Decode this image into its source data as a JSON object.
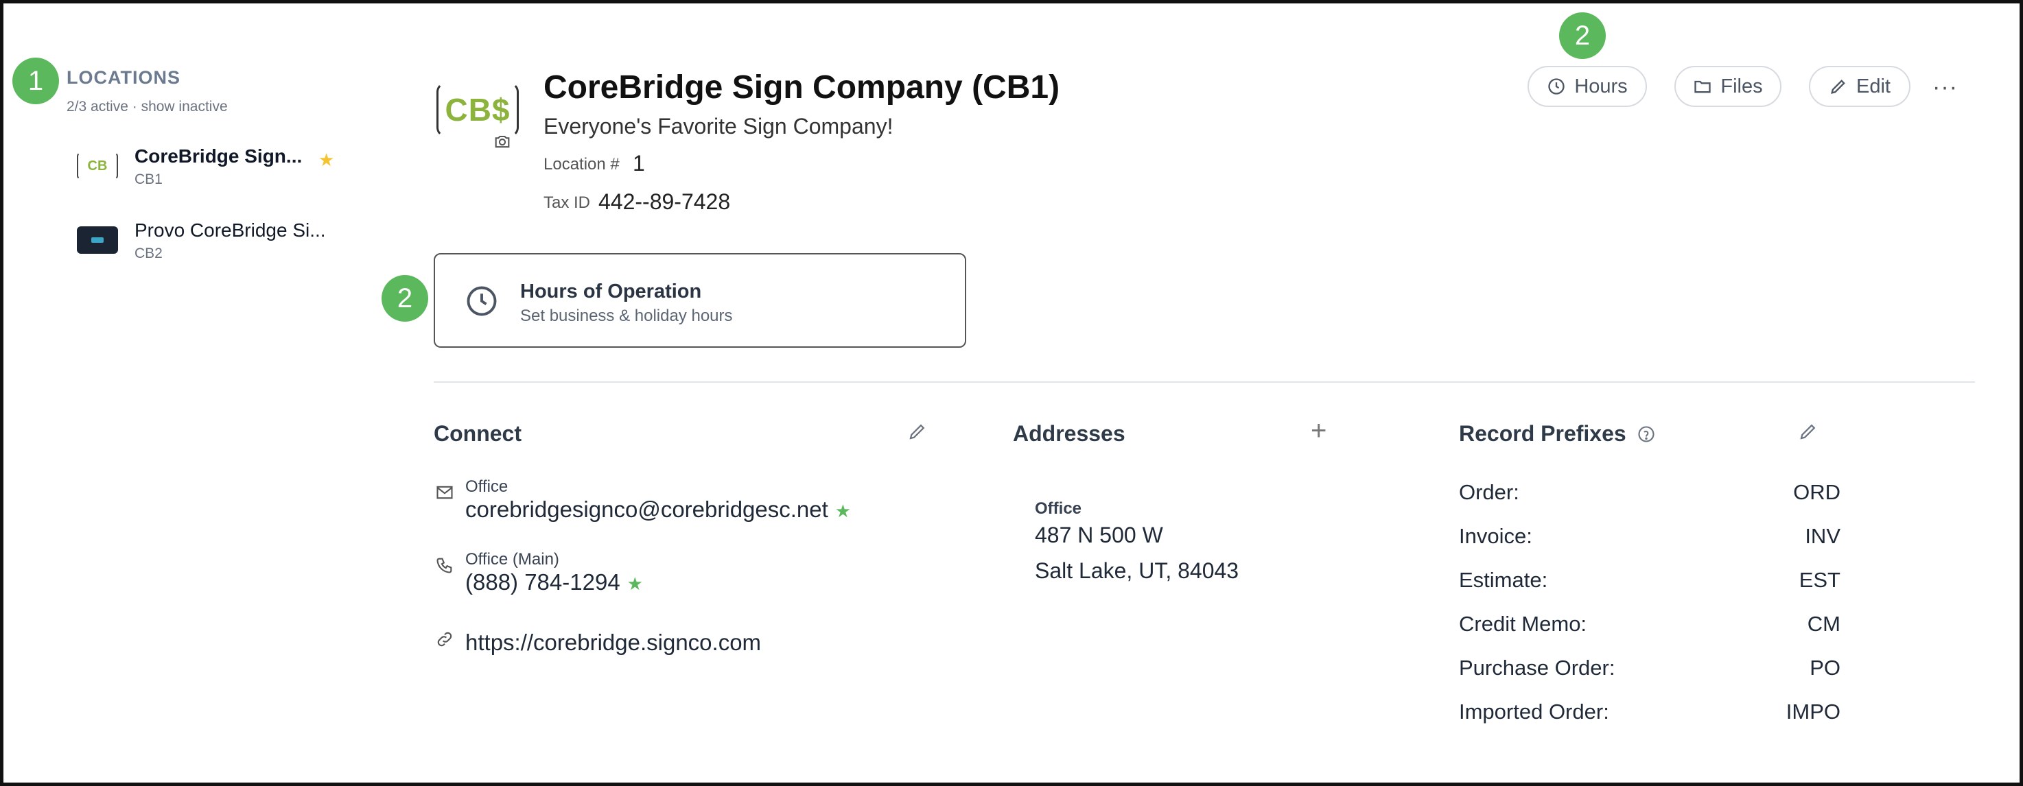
{
  "callouts": {
    "one": "1",
    "two_top": "2",
    "two_left": "2"
  },
  "sidebar": {
    "title": "LOCATIONS",
    "active_count": "2/3 active",
    "separator": "·",
    "show_inactive": "show inactive",
    "items": [
      {
        "name": "CoreBridge Sign...",
        "code": "CB1",
        "thumb": "CB",
        "starred": true
      },
      {
        "name": "Provo CoreBridge Si...",
        "code": "CB2"
      }
    ]
  },
  "header": {
    "logo_text": "CB$",
    "title": "CoreBridge Sign Company (CB1)",
    "subtitle": "Everyone's Favorite Sign Company!",
    "location_label": "Location #",
    "location_value": "1",
    "tax_label": "Tax ID",
    "tax_value": "442--89-7428"
  },
  "actions": {
    "hours": "Hours",
    "files": "Files",
    "edit": "Edit",
    "more": "···"
  },
  "hours_card": {
    "title": "Hours of Operation",
    "subtitle": "Set business & holiday hours"
  },
  "connect": {
    "title": "Connect",
    "email_label": "Office",
    "email": "corebridgesignco@corebridgesc.net",
    "phone_label": "Office (Main)",
    "phone": "(888) 784-1294",
    "website": "https://corebridge.signco.com"
  },
  "addresses": {
    "title": "Addresses",
    "add": "+",
    "label": "Office",
    "line1": "487 N 500 W",
    "line2": "Salt Lake, UT, 84043"
  },
  "record_prefixes": {
    "title": "Record Prefixes",
    "rows": [
      {
        "label": "Order:",
        "value": "ORD"
      },
      {
        "label": "Invoice:",
        "value": "INV"
      },
      {
        "label": "Estimate:",
        "value": "EST"
      },
      {
        "label": "Credit Memo:",
        "value": "CM"
      },
      {
        "label": "Purchase Order:",
        "value": "PO"
      },
      {
        "label": "Imported Order:",
        "value": "IMPO"
      }
    ]
  },
  "colors": {
    "accent_green": "#5cb85c",
    "star_yellow": "#f4c430",
    "logo_green": "#8cb43c"
  }
}
